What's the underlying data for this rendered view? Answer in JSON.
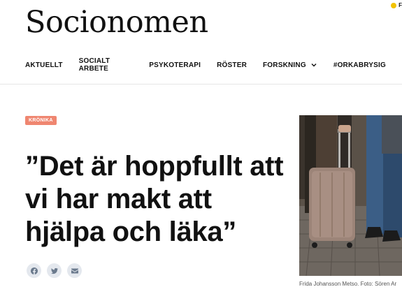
{
  "site": {
    "logo": "Socionomen",
    "corner_text": "F"
  },
  "nav": {
    "items": [
      {
        "label": "AKTUELLT"
      },
      {
        "label": "SOCIALT ARBETE"
      },
      {
        "label": "PSYKOTERAPI"
      },
      {
        "label": "RÖSTER"
      },
      {
        "label": "FORSKNING",
        "has_dropdown": true
      },
      {
        "label": "#ORKABRYSIG"
      }
    ]
  },
  "article": {
    "category": "KRÖNIKA",
    "title": "”Det är hoppfullt att vi har makt att hjälpa och läka”",
    "share": [
      {
        "icon": "facebook-icon"
      },
      {
        "icon": "twitter-icon"
      },
      {
        "icon": "email-icon"
      }
    ],
    "image_caption": "Frida Johansson Metso. Foto: Sören Ar"
  },
  "colors": {
    "tag": "#ef8670",
    "share_bg": "#e4e8ee",
    "corner_dot": "#f2c200"
  }
}
